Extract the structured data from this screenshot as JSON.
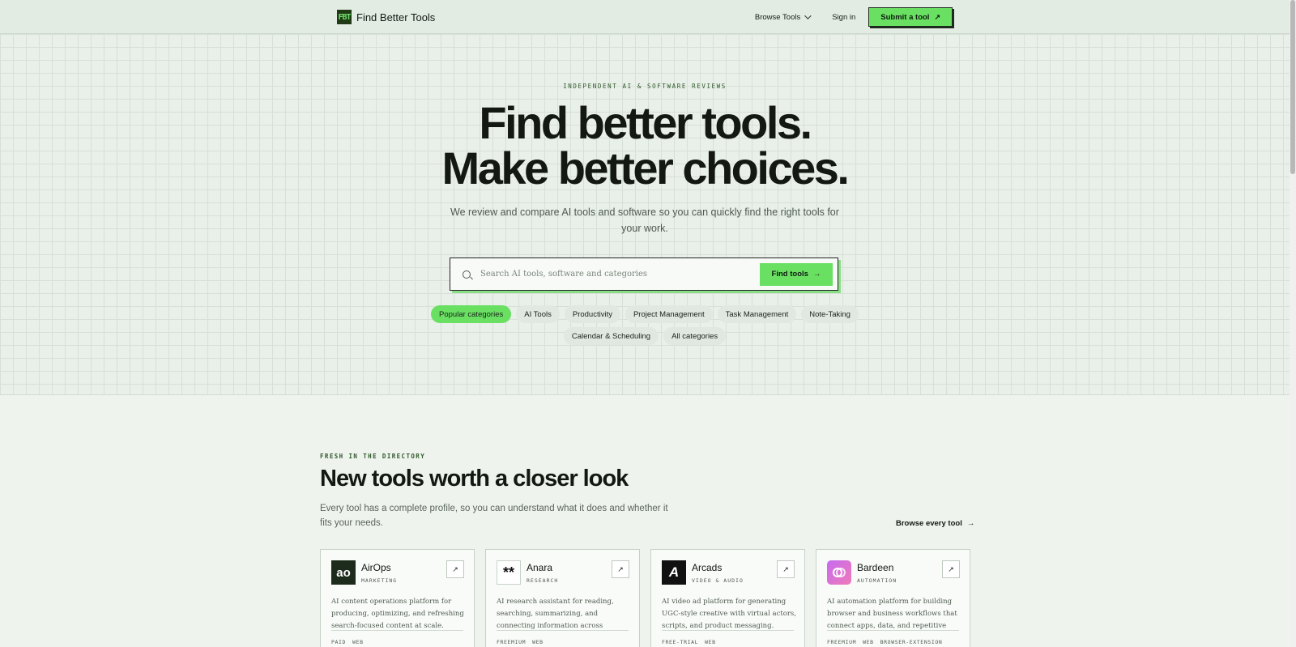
{
  "nav": {
    "brand_name": "Find Better Tools",
    "logo_text": "FBT",
    "browse_tools": "Browse Tools",
    "sign_in": "Sign in",
    "submit_tool": "Submit a tool"
  },
  "hero": {
    "eyebrow": "INDEPENDENT AI & SOFTWARE REVIEWS",
    "title_line1": "Find better tools.",
    "title_line2": "Make better choices.",
    "subtitle": "We review and compare AI tools and software so you can quickly find the right tools for your work.",
    "search_placeholder": "Search AI tools, software and categories",
    "find_button": "Find tools",
    "chips": [
      "Popular categories",
      "AI Tools",
      "Productivity",
      "Project Management",
      "Task Management",
      "Note-Taking",
      "Calendar & Scheduling",
      "All categories"
    ]
  },
  "section": {
    "eyebrow": "FRESH IN THE DIRECTORY",
    "title": "New tools worth a closer look",
    "subtitle": "Every tool has a complete profile, so you can understand what it does and whether it fits your needs.",
    "browse_all": "Browse every tool"
  },
  "cards": [
    {
      "name": "AirOps",
      "category": "MARKETING",
      "logo": "ao",
      "description": "AI content operations platform for producing, optimizing, and refreshing search-focused content at scale.",
      "tags": [
        "PAID",
        "WEB"
      ]
    },
    {
      "name": "Anara",
      "category": "RESEARCH",
      "logo": "**",
      "description": "AI research assistant for reading, searching, summarizing, and connecting information across academic sources a...",
      "tags": [
        "FREEMIUM",
        "WEB"
      ]
    },
    {
      "name": "Arcads",
      "category": "VIDEO & AUDIO",
      "logo": "A",
      "description": "AI video ad platform for generating UGC-style creative with virtual actors, scripts, and product messaging.",
      "tags": [
        "FREE-TRIAL",
        "WEB"
      ]
    },
    {
      "name": "Bardeen",
      "category": "AUTOMATION",
      "logo": "",
      "description": "AI automation platform for building browser and business workflows that connect apps, data, and repetitive tasks.",
      "tags": [
        "FREEMIUM",
        "WEB",
        "BROWSER-EXTENSION"
      ]
    }
  ]
}
